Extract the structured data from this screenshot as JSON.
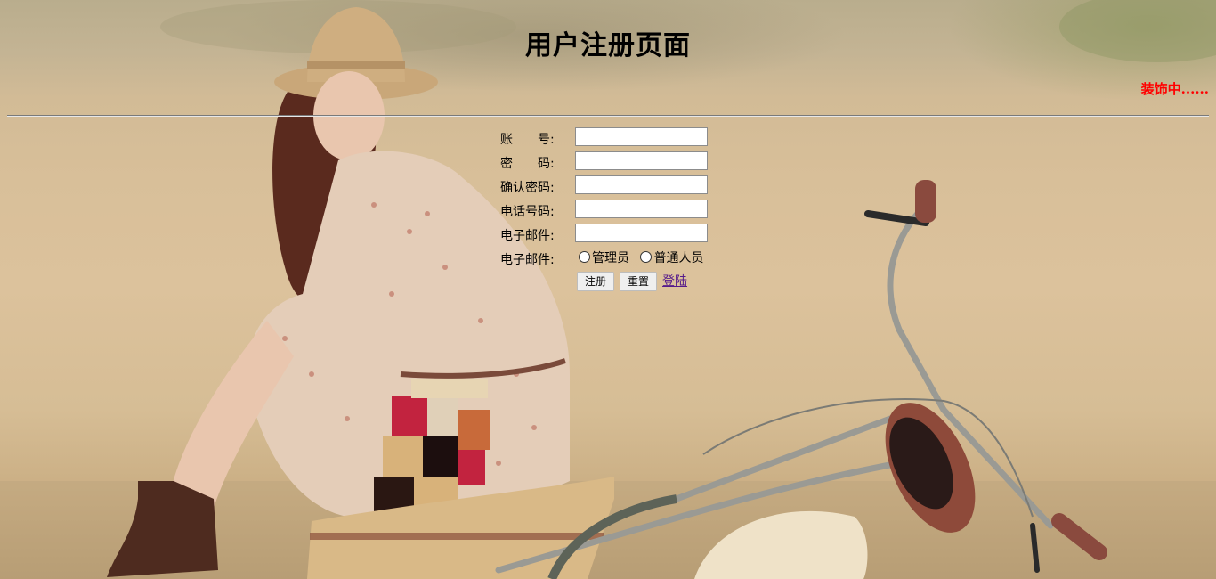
{
  "header": {
    "title": "用户注册页面",
    "decoration_text": "装饰中......"
  },
  "form": {
    "fields": [
      {
        "label": "账　　号:",
        "value": "",
        "placeholder": ""
      },
      {
        "label": "密　　码:",
        "value": "",
        "placeholder": ""
      },
      {
        "label": "确认密码:",
        "value": "",
        "placeholder": ""
      },
      {
        "label": "电话号码:",
        "value": "",
        "placeholder": ""
      },
      {
        "label": "电子邮件:",
        "value": "",
        "placeholder": ""
      }
    ],
    "role": {
      "label": "电子邮件:",
      "options": [
        "管理员",
        "普通人员"
      ]
    },
    "buttons": {
      "register": "注册",
      "reset": "重置",
      "login_link": "登陆"
    }
  },
  "colors": {
    "title": "#000000",
    "decoration_text": "#ff0000",
    "link": "#551a8b"
  },
  "background": {
    "description_icon": "photo-background"
  }
}
